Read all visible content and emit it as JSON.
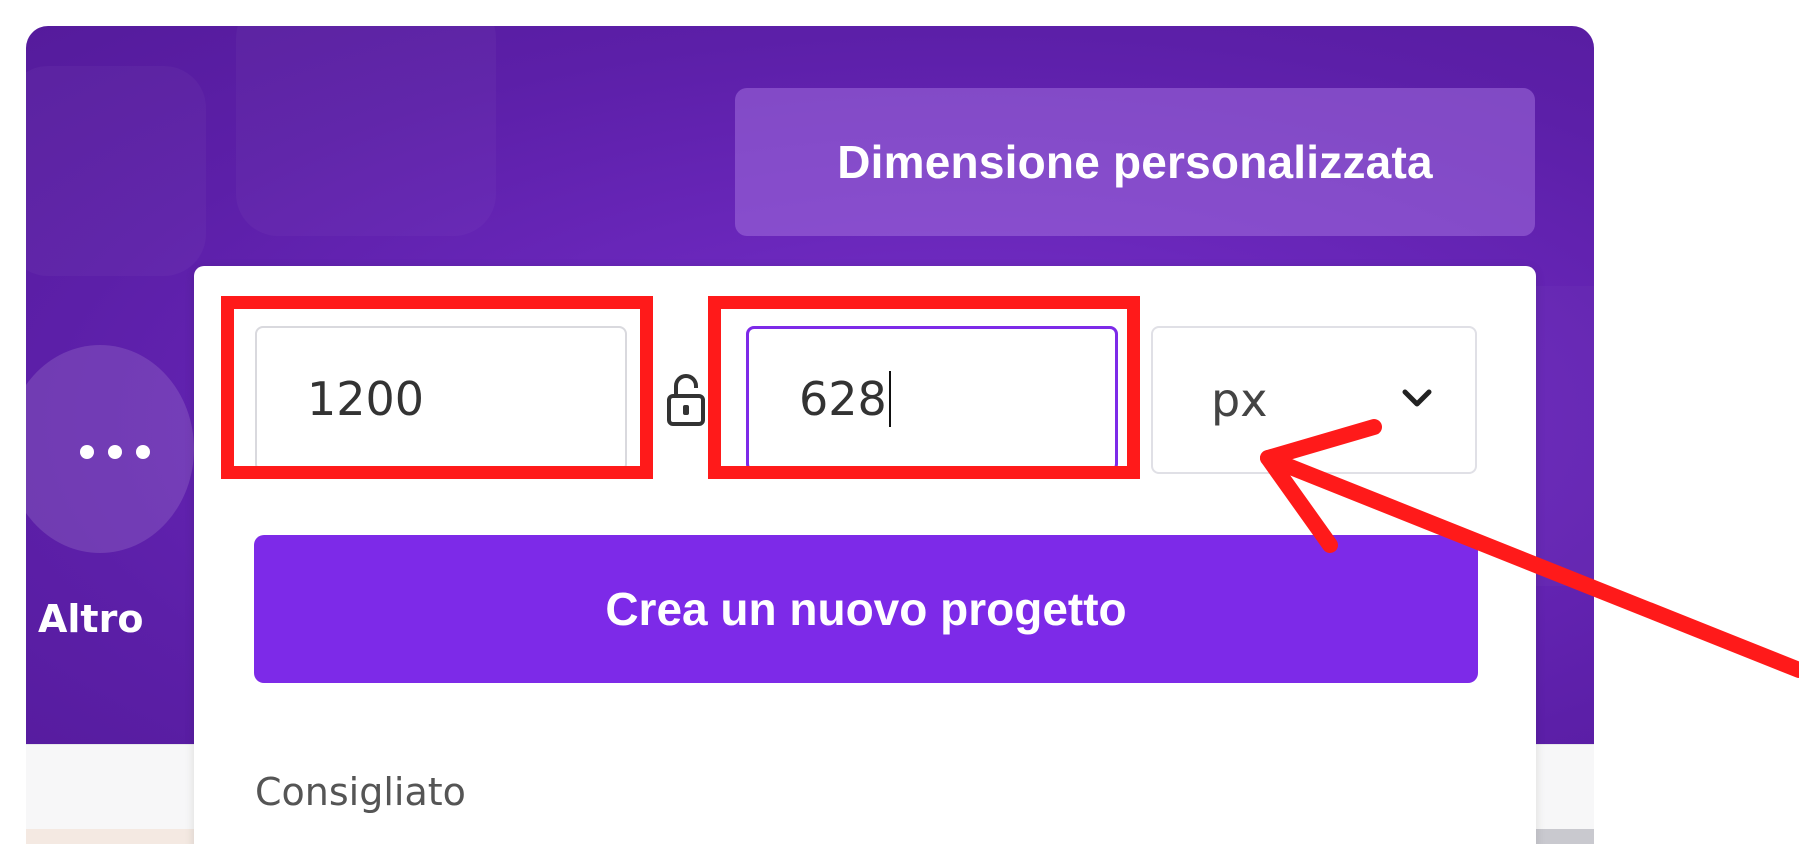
{
  "dialog": {
    "custom_size_label": "Dimensione personalizzata",
    "width_value": "1200",
    "height_value": "628",
    "unit_selected": "px",
    "create_button_label": "Crea un nuovo progetto",
    "recommended_label": "Consigliato"
  },
  "sidebar": {
    "more_label": "Altro"
  },
  "icons": {
    "lock": "unlocked-padlock-icon",
    "unit_dropdown": "chevron-down-icon",
    "more": "more-dots-icon"
  },
  "colors": {
    "hero_purple": "#6a27bb",
    "accent_purple": "#7d2ae8",
    "annotation_red": "#ff1a1a"
  }
}
